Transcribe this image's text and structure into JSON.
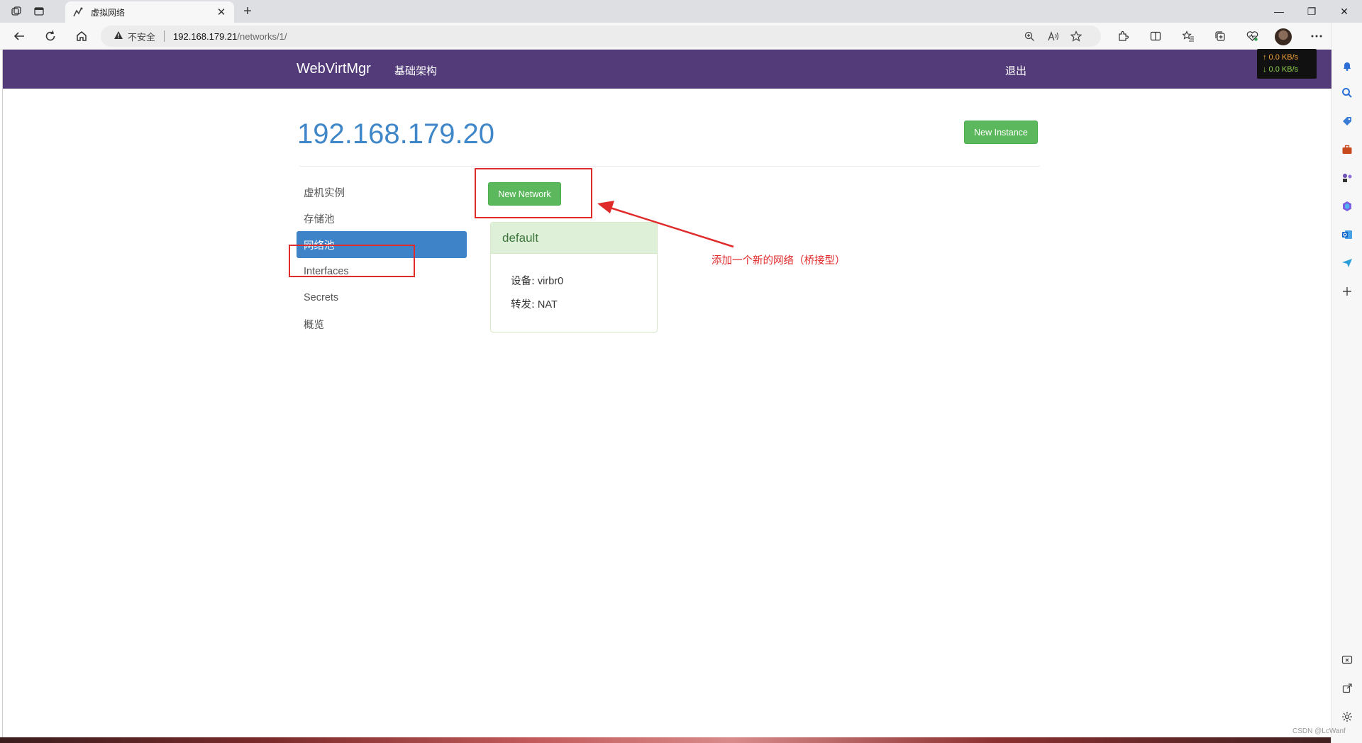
{
  "browser": {
    "tab_title": "虚拟网络",
    "close_tab_glyph": "✕",
    "new_tab_glyph": "+",
    "security_label": "不安全",
    "url_host": "192.168.179.21",
    "url_path": "/networks/1/",
    "window_controls": {
      "minimize": "—",
      "restore": "❐",
      "close": "✕"
    }
  },
  "net_speed": {
    "up": "↑ 0.0 KB/s",
    "down": "↓ 0.0 KB/s"
  },
  "navbar": {
    "brand": "WebVirtMgr",
    "infra_link": "基础架构",
    "logout_link": "退出"
  },
  "host": {
    "title": "192.168.179.20",
    "new_instance_label": "New Instance"
  },
  "sidebar": {
    "items": [
      {
        "label": "虚机实例"
      },
      {
        "label": "存储池"
      },
      {
        "label": "网络池"
      },
      {
        "label": "Interfaces"
      },
      {
        "label": "Secrets"
      },
      {
        "label": "概览"
      }
    ],
    "active_index": 2
  },
  "networks": {
    "new_network_label": "New Network",
    "cards": [
      {
        "name": "default",
        "device_label": "设备:",
        "device": "virbr0",
        "forward_label": "转发:",
        "forward": "NAT"
      }
    ]
  },
  "annotation": {
    "text": "添加一个新的网络（桥接型）"
  },
  "watermark": "CSDN @LcWanf",
  "colors": {
    "navbar": "#533b7a",
    "accent_blue": "#3e83c7",
    "success_green": "#5cb85c",
    "annotation_red": "#e02b2b"
  }
}
